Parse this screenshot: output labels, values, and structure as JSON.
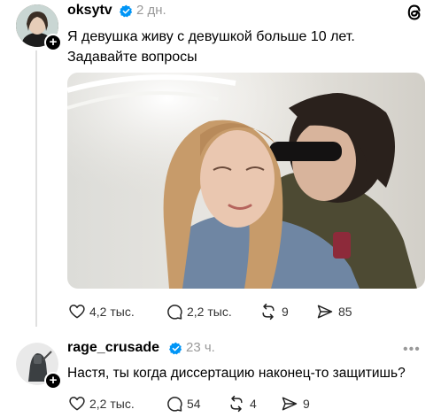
{
  "post1": {
    "username": "oksytv",
    "time": "2 дн.",
    "text_line1": "Я девушка живу с девушкой больше 10 лет.",
    "text_line2": "Задавайте вопросы",
    "likes": "4,2 тыс.",
    "comments": "2,2 тыс.",
    "reposts": "9",
    "shares": "85"
  },
  "post2": {
    "username": "rage_crusade",
    "time": "23 ч.",
    "text": "Настя, ты когда диссертацию наконец-то защитишь?",
    "likes": "2,2 тыс.",
    "comments": "54",
    "reposts": "4",
    "shares": "9"
  },
  "colors": {
    "verified": "#0095f6",
    "secondary_text": "#999999",
    "thread_line": "#e0e0e0"
  },
  "icons": {
    "app_logo": "threads-logo-icon",
    "like": "heart-icon",
    "comment": "speech-bubble-icon",
    "repost": "repost-icon",
    "share": "send-icon",
    "verified": "verified-badge-icon"
  }
}
